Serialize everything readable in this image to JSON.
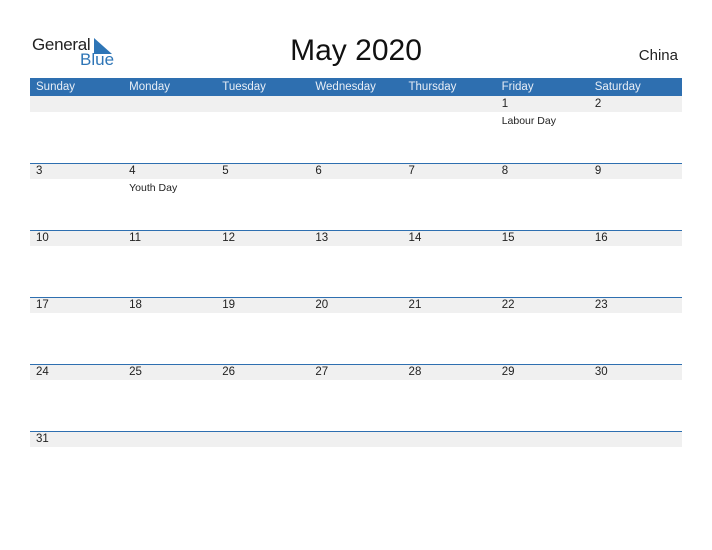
{
  "logo": {
    "text_general": "General",
    "text_blue": "Blue"
  },
  "title": "May 2020",
  "country": "China",
  "colors": {
    "accent": "#2e6fb0",
    "band": "#f0f0f0"
  },
  "weekdays": [
    "Sunday",
    "Monday",
    "Tuesday",
    "Wednesday",
    "Thursday",
    "Friday",
    "Saturday"
  ],
  "weeks": [
    [
      {
        "day": ""
      },
      {
        "day": ""
      },
      {
        "day": ""
      },
      {
        "day": ""
      },
      {
        "day": ""
      },
      {
        "day": "1",
        "holiday": "Labour Day"
      },
      {
        "day": "2"
      }
    ],
    [
      {
        "day": "3"
      },
      {
        "day": "4",
        "holiday": "Youth Day"
      },
      {
        "day": "5"
      },
      {
        "day": "6"
      },
      {
        "day": "7"
      },
      {
        "day": "8"
      },
      {
        "day": "9"
      }
    ],
    [
      {
        "day": "10"
      },
      {
        "day": "11"
      },
      {
        "day": "12"
      },
      {
        "day": "13"
      },
      {
        "day": "14"
      },
      {
        "day": "15"
      },
      {
        "day": "16"
      }
    ],
    [
      {
        "day": "17"
      },
      {
        "day": "18"
      },
      {
        "day": "19"
      },
      {
        "day": "20"
      },
      {
        "day": "21"
      },
      {
        "day": "22"
      },
      {
        "day": "23"
      }
    ],
    [
      {
        "day": "24"
      },
      {
        "day": "25"
      },
      {
        "day": "26"
      },
      {
        "day": "27"
      },
      {
        "day": "28"
      },
      {
        "day": "29"
      },
      {
        "day": "30"
      }
    ],
    [
      {
        "day": "31"
      },
      {
        "day": ""
      },
      {
        "day": ""
      },
      {
        "day": ""
      },
      {
        "day": ""
      },
      {
        "day": ""
      },
      {
        "day": ""
      }
    ]
  ]
}
